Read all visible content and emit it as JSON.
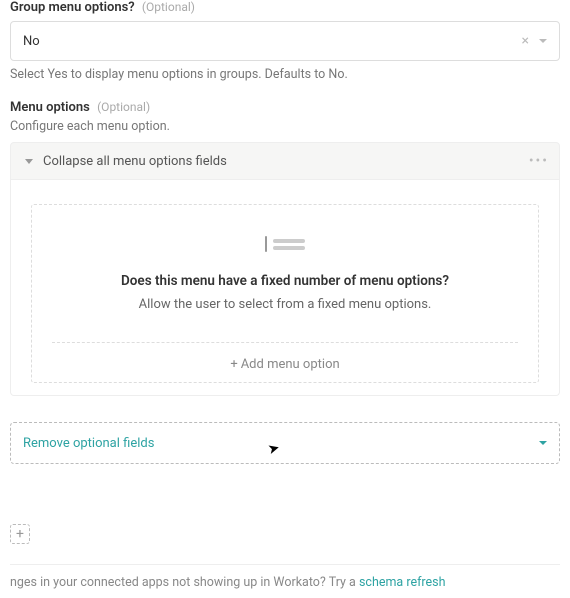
{
  "group_menu": {
    "label": "Group menu options?",
    "optional": "(Optional)",
    "value": "No",
    "help": "Select Yes to display menu options in groups. Defaults to No."
  },
  "menu_options": {
    "label": "Menu options",
    "optional": "(Optional)",
    "desc": "Configure each menu option.",
    "collapse_label": "Collapse all menu options fields",
    "empty_title": "Does this menu have a fixed number of menu options?",
    "empty_sub": "Allow the user to select from a fixed menu options.",
    "add_label": "Add menu option"
  },
  "remove_fields": {
    "label": "Remove optional fields"
  },
  "add_step": {
    "plus": "+"
  },
  "footer": {
    "text_prefix": "nges in your connected apps not showing up in Workato? Try a ",
    "link": "schema refresh"
  }
}
